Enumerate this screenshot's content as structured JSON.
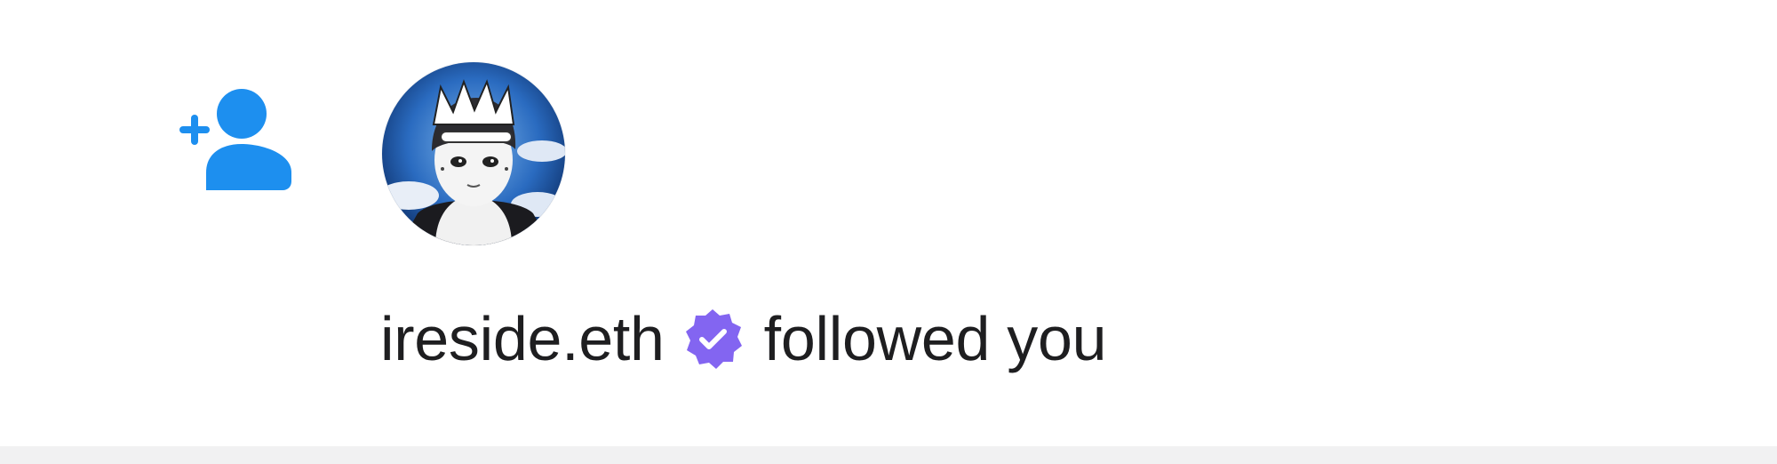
{
  "notification": {
    "type_icon": "add-user-icon",
    "username": "ireside.eth",
    "verified_icon": "verified-badge-icon",
    "action_text": "followed you"
  },
  "colors": {
    "follow_icon": "#1d8fef",
    "verified_badge": "#8365f1",
    "text": "#1e1e20",
    "divider": "#f1f1f2"
  }
}
